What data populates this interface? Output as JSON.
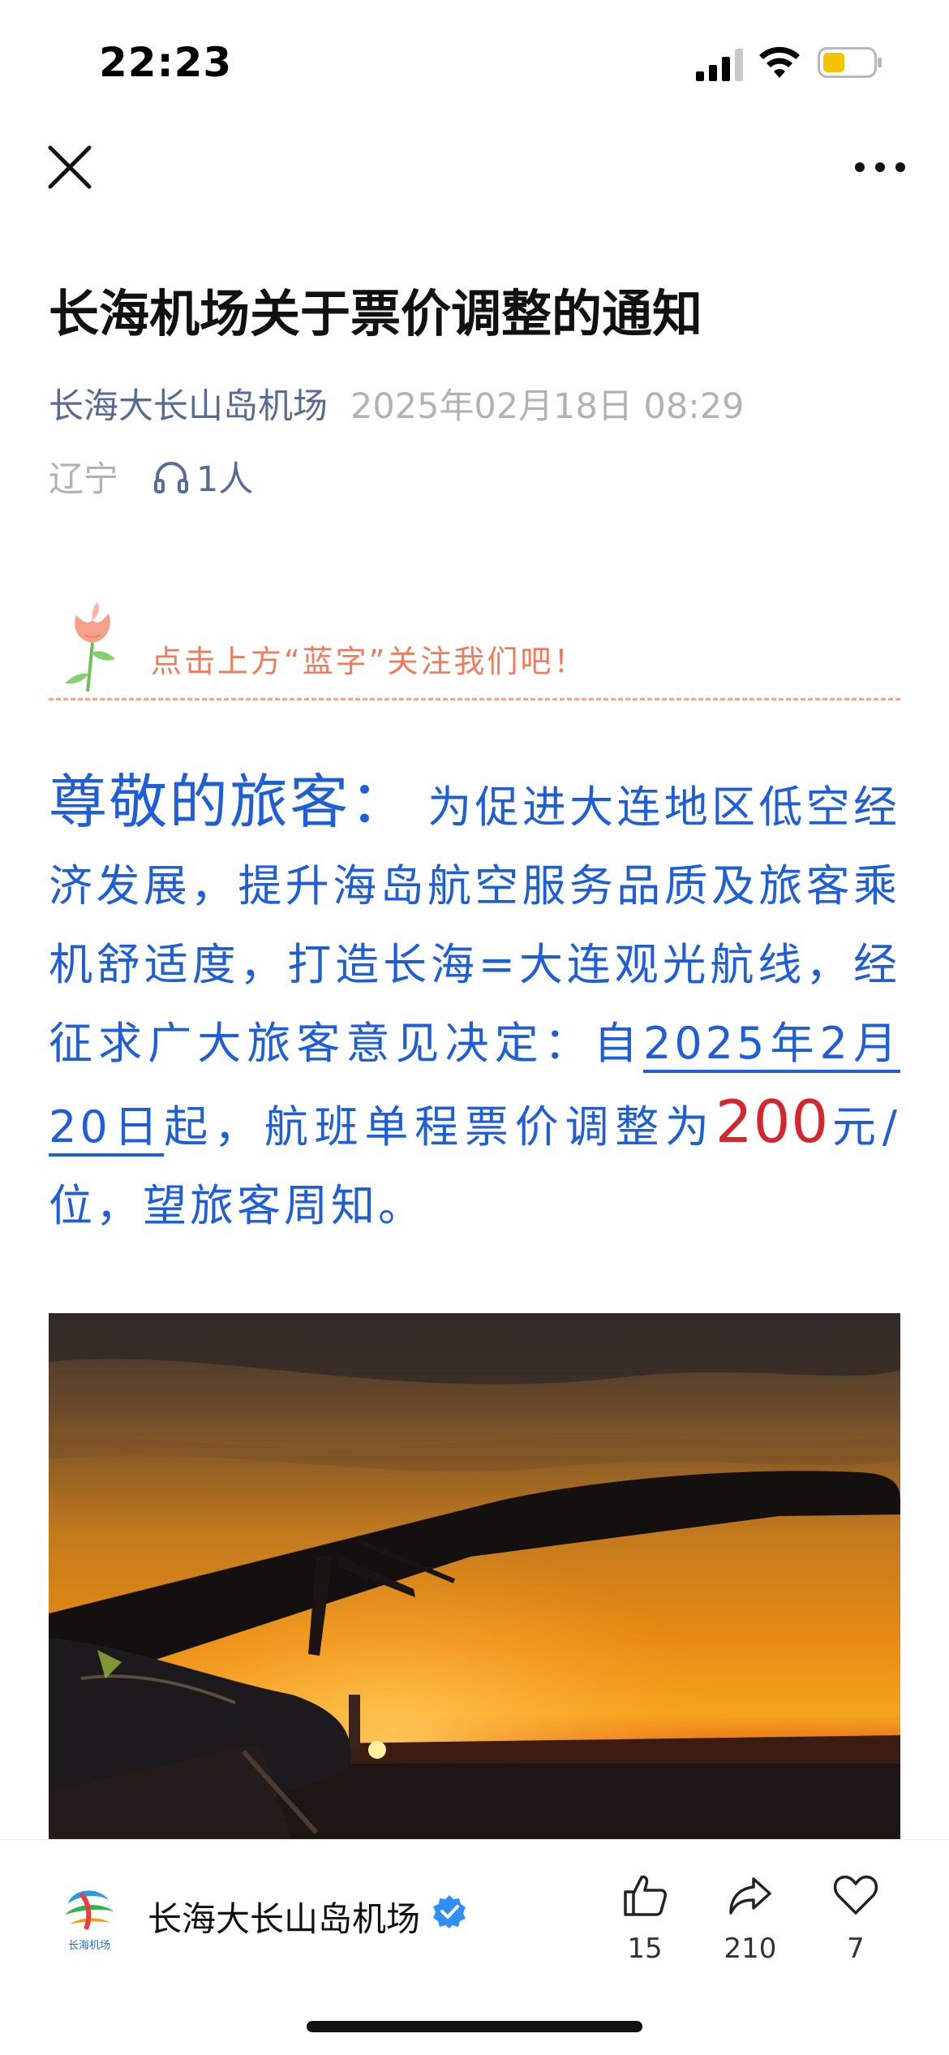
{
  "status_bar": {
    "time": "22:23",
    "battery_color": "#f5c400"
  },
  "nav": {
    "close_icon": "close-icon",
    "more_icon": "more-icon"
  },
  "article": {
    "title": "长海机场关于票价调整的通知",
    "author": "长海大长山岛机场",
    "date": "2025年02月18日 08:29",
    "location": "辽宁",
    "listeners": "1人"
  },
  "follow_banner": {
    "text": "点击上方“蓝字”关注我们吧！"
  },
  "body": {
    "greeting": "尊敬的旅客：",
    "text_1": "为促进大连地区低空经济发展，提升海岛航空服务品质及旅客乘机舒适度，打造长海=大连观光航线，经征求广大旅客意见决定：自",
    "date_underlined": "2025年2月20日",
    "text_2": "起，航班单程票价调整为",
    "price": "200",
    "text_3": "元/位，望旅客周知。"
  },
  "photo": {
    "subject": "aircraft wing silhouette at sunset"
  },
  "bottom_bar": {
    "account_name": "长海大长山岛机场",
    "logo_caption": "长海机场",
    "likes": "15",
    "shares": "210",
    "favorites": "7"
  },
  "colors": {
    "link_blue": "#576b95",
    "body_blue": "#1e5fd8",
    "price_red": "#d4262e",
    "banner_orange": "#f07b5a"
  }
}
